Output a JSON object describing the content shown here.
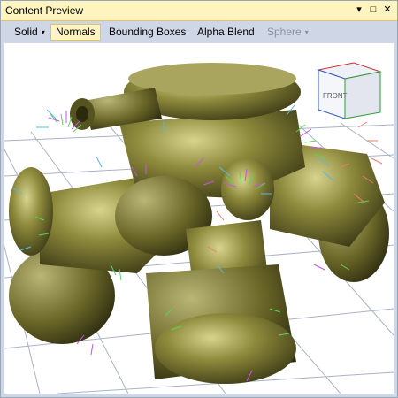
{
  "window": {
    "title": "Content Preview",
    "controls": {
      "dropdown_glyph": "▾",
      "maximize_glyph": "□",
      "close_glyph": "✕"
    }
  },
  "toolbar": {
    "items": [
      {
        "label": "Solid",
        "has_dropdown": true,
        "state": "normal"
      },
      {
        "label": "Normals",
        "has_dropdown": false,
        "state": "active"
      },
      {
        "label": "Bounding Boxes",
        "has_dropdown": false,
        "state": "normal"
      },
      {
        "label": "Alpha Blend",
        "has_dropdown": false,
        "state": "normal"
      },
      {
        "label": "Sphere",
        "has_dropdown": true,
        "state": "disabled"
      }
    ],
    "caret_glyph": "▾"
  },
  "viewport": {
    "cube_label": "FRONT",
    "colors": {
      "background": "#ffffff",
      "grid": "#a8b3c3",
      "model": "#6b6b2a",
      "highlight": "#c9c780"
    }
  }
}
